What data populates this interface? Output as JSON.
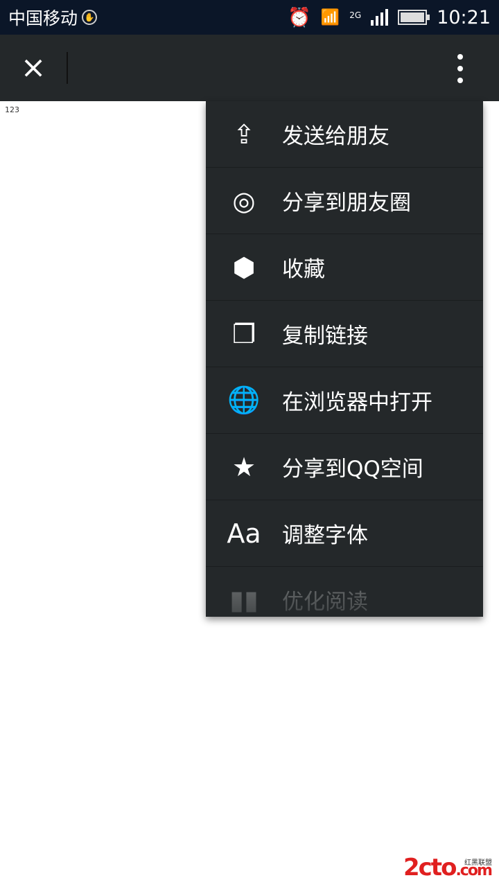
{
  "status_bar": {
    "carrier": "中国移动",
    "network": "2G",
    "time": "10:21"
  },
  "toolbar": {
    "close_icon": "×"
  },
  "page": {
    "text": "123"
  },
  "menu": {
    "items": [
      {
        "label": "发送给朋友",
        "icon": "share-icon",
        "glyph": "⇪"
      },
      {
        "label": "分享到朋友圈",
        "icon": "aperture-icon",
        "glyph": "◎"
      },
      {
        "label": "收藏",
        "icon": "cube-icon",
        "glyph": "⬢"
      },
      {
        "label": "复制链接",
        "icon": "copy-icon",
        "glyph": "❐"
      },
      {
        "label": "在浏览器中打开",
        "icon": "globe-icon",
        "glyph": "🌐"
      },
      {
        "label": "分享到QQ空间",
        "icon": "qzone-star-icon",
        "glyph": "★"
      },
      {
        "label": "调整字体",
        "icon": "font-icon",
        "glyph": "Aa"
      },
      {
        "label": "优化阅读",
        "icon": "book-icon",
        "glyph": "▮▮"
      }
    ]
  },
  "watermark": {
    "text": "2cto",
    "suffix": ".com",
    "sub": "红黑联盟"
  }
}
